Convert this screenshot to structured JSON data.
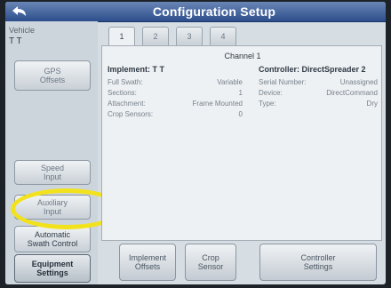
{
  "title": "Configuration Setup",
  "vehicle": {
    "label": "Vehicle",
    "value": "T T"
  },
  "sidebar": {
    "gps_offsets": "GPS\nOffsets",
    "speed_input": "Speed\nInput",
    "auxiliary_input": "Auxiliary\nInput",
    "automatic_swath_control": "Automatic\nSwath Control",
    "equipment_settings": "Equipment\nSettings"
  },
  "tabs": [
    "1",
    "2",
    "3",
    "4"
  ],
  "channel": "Channel 1",
  "implement": {
    "heading": "Implement: T T",
    "rows": [
      {
        "label": "Full Swath:",
        "value": "Variable"
      },
      {
        "label": "Sections:",
        "value": "1"
      },
      {
        "label": "Attachment:",
        "value": "Frame Mounted"
      },
      {
        "label": "Crop Sensors:",
        "value": "0"
      }
    ]
  },
  "controller": {
    "heading": "Controller: DirectSpreader 2",
    "rows": [
      {
        "label": "Serial Number:",
        "value": "Unassigned"
      },
      {
        "label": "Device:",
        "value": "DirectCommand"
      },
      {
        "label": "Type:",
        "value": "Dry"
      }
    ]
  },
  "buttons": {
    "implement_offsets": "Implement\nOffsets",
    "crop_sensor": "Crop\nSensor",
    "controller_settings": "Controller\nSettings"
  },
  "colors": {
    "title_bar": "#2c4e8c",
    "highlight": "#f2e21c"
  }
}
